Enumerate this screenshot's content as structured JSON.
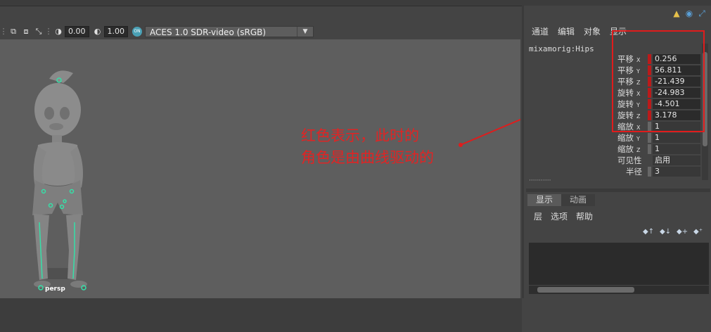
{
  "toolbar": {
    "exposure_value": "0.00",
    "gamma_value": "1.00",
    "on_badge": "ON",
    "color_space": "ACES 1.0 SDR-video (sRGB)"
  },
  "viewport": {
    "camera_label": "persp",
    "annotation_lines": [
      "红色表示，此时的",
      "角色是由曲线驱动的"
    ]
  },
  "channel_box": {
    "menu": [
      "通道",
      "编辑",
      "对象",
      "显示"
    ],
    "node_name": "mixamorig:Hips",
    "channels": [
      {
        "label": "平移",
        "axis": "X",
        "value": "0.256",
        "keyed": true
      },
      {
        "label": "平移",
        "axis": "Y",
        "value": "56.811",
        "keyed": true
      },
      {
        "label": "平移",
        "axis": "Z",
        "value": "-21.439",
        "keyed": true
      },
      {
        "label": "旋转",
        "axis": "X",
        "value": "-24.983",
        "keyed": true
      },
      {
        "label": "旋转",
        "axis": "Y",
        "value": "-4.501",
        "keyed": true
      },
      {
        "label": "旋转",
        "axis": "Z",
        "value": "3.178",
        "keyed": true
      },
      {
        "label": "缩放",
        "axis": "X",
        "value": "1",
        "keyed": false
      },
      {
        "label": "缩放",
        "axis": "Y",
        "value": "1",
        "keyed": false
      },
      {
        "label": "缩放",
        "axis": "Z",
        "value": "1",
        "keyed": false
      },
      {
        "label": "可见性",
        "axis": "",
        "value": "启用",
        "keyed": false
      },
      {
        "label": "半径",
        "axis": "",
        "value": "3",
        "keyed": false
      }
    ]
  },
  "layer_editor": {
    "tabs": [
      "显示",
      "动画"
    ],
    "menu": [
      "层",
      "选项",
      "帮助"
    ]
  },
  "colors": {
    "keyed": "#bb1a1a",
    "highlight": "#e01c1c",
    "joint": "#35e0a8"
  }
}
